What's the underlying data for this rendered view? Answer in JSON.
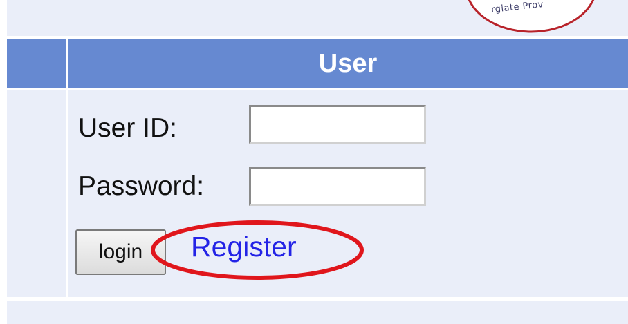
{
  "top": {
    "seal_text": "rgiate Prov"
  },
  "header": {
    "title": "User"
  },
  "form": {
    "user_id_label": "User ID:",
    "user_id_value": "",
    "password_label": "Password:",
    "password_value": "",
    "login_label": "login",
    "register_label": "Register"
  },
  "colors": {
    "header_bg": "#6689d1",
    "panel_bg": "#eaeef9",
    "link": "#2323e6",
    "annotation": "#e0161c"
  }
}
